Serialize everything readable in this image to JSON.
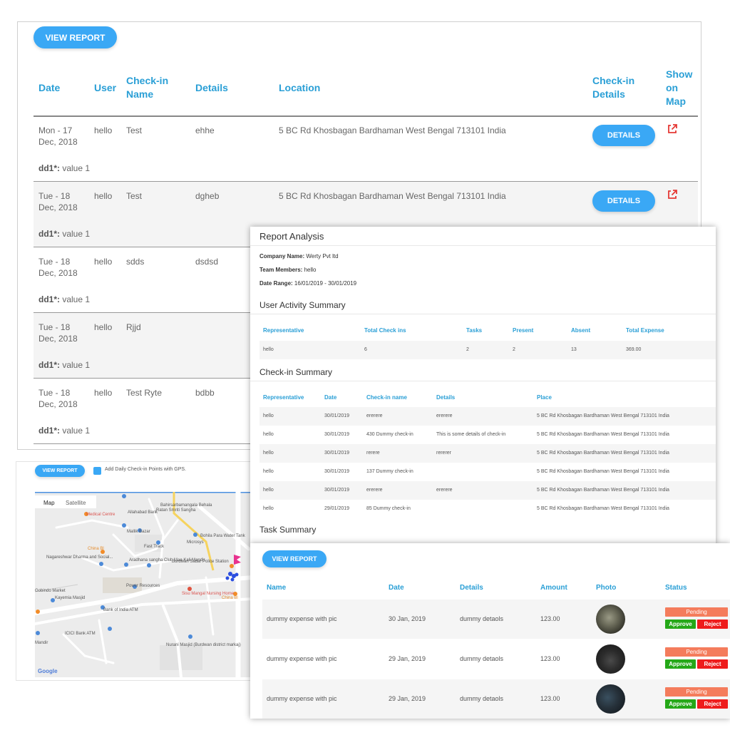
{
  "checkin_report": {
    "view_report_label": "VIEW REPORT",
    "headers": {
      "date": "Date",
      "user": "User",
      "checkin_name": "Check-in Name",
      "details": "Details",
      "location": "Location",
      "checkin_details": "Check-in Details",
      "show_on_map": "Show on Map"
    },
    "details_button_label": "DETAILS",
    "rows": [
      {
        "date": "Mon - 17 Dec, 2018",
        "user": "hello",
        "name": "Test",
        "details": "ehhe",
        "location": "5 BC Rd Khosbagan Bardhaman West Bengal 713101 India",
        "field_label": "dd1*:",
        "field_value": "value 1"
      },
      {
        "date": "Tue - 18 Dec, 2018",
        "user": "hello",
        "name": "Test",
        "details": "dgheb",
        "location": "5 BC Rd Khosbagan Bardhaman West Bengal 713101 India",
        "field_label": "dd1*:",
        "field_value": "value 1"
      },
      {
        "date": "Tue - 18 Dec, 2018",
        "user": "hello",
        "name": "sdds",
        "details": "dsdsd",
        "location": "",
        "field_label": "dd1*:",
        "field_value": "value 1"
      },
      {
        "date": "Tue - 18 Dec, 2018",
        "user": "hello",
        "name": "Rjjd",
        "details": "",
        "location": "",
        "field_label": "dd1*:",
        "field_value": "value 1"
      },
      {
        "date": "Tue - 18 Dec, 2018",
        "user": "hello",
        "name": "Test Ryte",
        "details": "bdbb",
        "location": "",
        "field_label": "dd1*:",
        "field_value": "value 1"
      }
    ]
  },
  "map_panel": {
    "view_report_label": "VIEW REPORT",
    "checkbox_label": "Add Daily Check-in Points with GPS.",
    "tab_map": "Map",
    "tab_satellite": "Satellite",
    "google_label": "Google",
    "labels": [
      "Bahirsarbamangala Rd",
      "Medical Centre",
      "Allahabad Bank",
      "Bahirsarbamangala Behala",
      "Ratan Smriti Sangha",
      "Bohila Para Water Tank",
      "Mallik Bazar",
      "China Bl",
      "Fast Track",
      "Microsys",
      "Nagareshwar Dharma and Social...",
      "Aradhana sangha Club Maa Kali Mandir",
      "Burdwan Sadar Police Station",
      "Power Resources",
      "Kayemia Masjid",
      "Bank of India ATM",
      "Sisu Mangal Nursing Home",
      "China Bl",
      "ICICI Bank ATM",
      "Nurani Masjid (Burdwan district markaj)",
      "Gobindo Market",
      "Mandir"
    ]
  },
  "report_analysis": {
    "title": "Report Analysis",
    "company_label": "Company Name:",
    "company_value": "Werty Pvt ltd",
    "team_label": "Team Members:",
    "team_value": "hello",
    "range_label": "Date Range:",
    "range_value": "16/01/2019 - 30/01/2019",
    "activity_title": "User Activity Summary",
    "activity_headers": [
      "Representative",
      "Total Check ins",
      "Tasks",
      "Present",
      "Absent",
      "Total Expense"
    ],
    "activity_row": [
      "hello",
      "6",
      "2",
      "2",
      "13",
      "369.00"
    ],
    "checkin_title": "Check-in Summary",
    "checkin_headers": [
      "Representative",
      "Date",
      "Check-in name",
      "Details",
      "Place"
    ],
    "checkin_rows": [
      [
        "hello",
        "30/01/2019",
        "ererere",
        "ererere",
        "5 BC Rd Khosbagan Bardhaman West Bengal 713101 India"
      ],
      [
        "hello",
        "30/01/2019",
        "430 Dummy check-in",
        "This is some details of check-in",
        "5 BC Rd Khosbagan Bardhaman West Bengal 713101 India"
      ],
      [
        "hello",
        "30/01/2019",
        "rerere",
        "rererer",
        "5 BC Rd Khosbagan Bardhaman West Bengal 713101 India"
      ],
      [
        "hello",
        "30/01/2019",
        "137 Dummy check-in",
        "",
        "5 BC Rd Khosbagan Bardhaman West Bengal 713101 India"
      ],
      [
        "hello",
        "30/01/2019",
        "ererere",
        "ererere",
        "5 BC Rd Khosbagan Bardhaman West Bengal 713101 India"
      ],
      [
        "hello",
        "29/01/2019",
        "85 Dummy check-in",
        "",
        "5 BC Rd Khosbagan Bardhaman West Bengal 713101 India"
      ]
    ],
    "task_title": "Task Summary"
  },
  "expenses": {
    "view_report_label": "VIEW REPORT",
    "headers": [
      "Name",
      "Date",
      "Details",
      "Amount",
      "Photo",
      "Status"
    ],
    "pending_label": "Pending",
    "approve_label": "Approve",
    "reject_label": "Reject",
    "rows": [
      {
        "name": "dummy expense with pic",
        "date": "30 Jan, 2019",
        "details": "dummy detaols",
        "amount": "123.00"
      },
      {
        "name": "dummy expense with pic",
        "date": "29 Jan, 2019",
        "details": "dummy detaols",
        "amount": "123.00"
      },
      {
        "name": "dummy expense with pic",
        "date": "29 Jan, 2019",
        "details": "dummy detaols",
        "amount": "123.00"
      }
    ]
  },
  "colors": {
    "accent_blue": "#3aa8f5",
    "header_blue": "#2a9fd6",
    "pending": "#f47c5c",
    "approve": "#25a818",
    "reject": "#ee1c1c",
    "map_link": "#e53935"
  }
}
